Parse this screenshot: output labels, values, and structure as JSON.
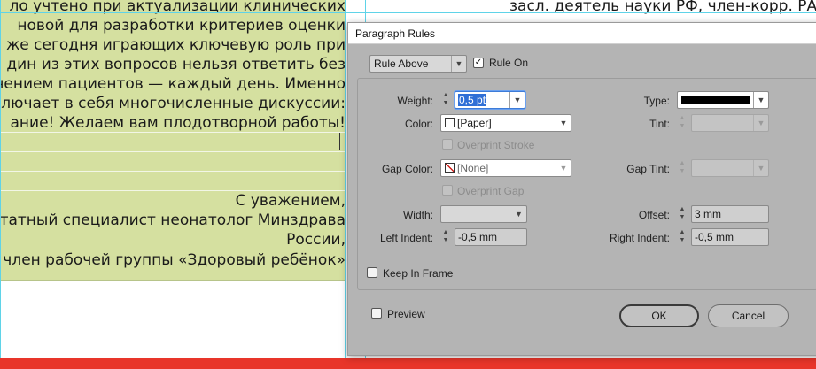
{
  "document": {
    "left_lines": [
      "ло учтено при актуализации клинических",
      "новой для разработки критериев оценки",
      "же сегодня играющих ключевую роль при",
      "дин из этих вопросов нельзя ответить без",
      "ечением пациентов — каждый день. Именно",
      "ключает в себя многочисленные дискуссии:",
      "ание! Желаем вам плодотворной работы!"
    ],
    "signature_lines": [
      "С уважением,",
      "штатный специалист неонатолог Минздрава",
      "России,",
      "член рабочей группы «Здоровый ребёнок»"
    ],
    "right_lines": [
      "засл. деятель науки РФ, член-корр. РАН"
    ]
  },
  "dialog": {
    "title": "Paragraph Rules",
    "rule_select": "Rule Above",
    "rule_on": {
      "label": "Rule On",
      "checked": true
    },
    "weight": {
      "label": "Weight:",
      "value": "0,5 pt"
    },
    "type": {
      "label": "Type:"
    },
    "color": {
      "label": "Color:",
      "value": "[Paper]"
    },
    "tint": {
      "label": "Tint:",
      "value": ""
    },
    "overprint_stroke": {
      "label": "Overprint Stroke",
      "checked": false,
      "enabled": false
    },
    "gap_color": {
      "label": "Gap Color:",
      "value": "[None]"
    },
    "gap_tint": {
      "label": "Gap Tint:",
      "value": ""
    },
    "overprint_gap": {
      "label": "Overprint Gap",
      "checked": false,
      "enabled": false
    },
    "width": {
      "label": "Width:",
      "value": ""
    },
    "offset": {
      "label": "Offset:",
      "value": "3 mm"
    },
    "left_indent": {
      "label": "Left Indent:",
      "value": "-0,5 mm"
    },
    "right_indent": {
      "label": "Right Indent:",
      "value": "-0,5 mm"
    },
    "keep_in_frame": {
      "label": "Keep In Frame",
      "checked": false
    },
    "preview": {
      "label": "Preview",
      "checked": false
    },
    "ok_label": "OK",
    "cancel_label": "Cancel"
  },
  "colors": {
    "frame_fill": "#d5e0a0",
    "guide": "#5fd3e8",
    "bottom_bar": "#e8352a",
    "dialog_bg": "#b4b4b4",
    "focus": "#3d7bd8"
  }
}
